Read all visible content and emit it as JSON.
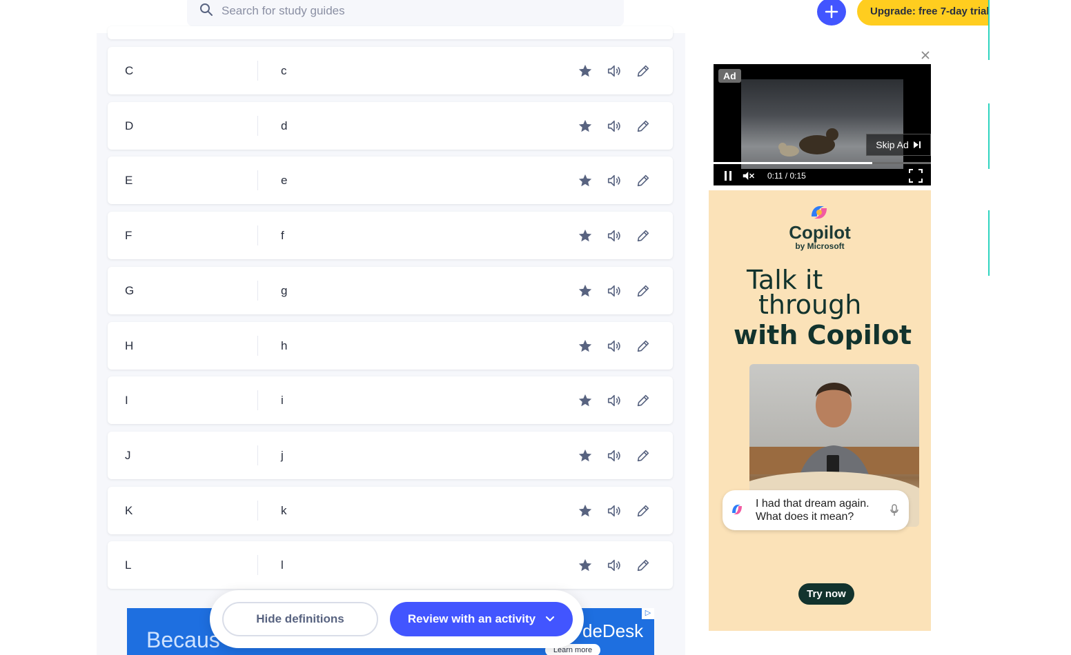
{
  "header": {
    "search_placeholder": "Search for study guides",
    "upgrade_label": "Upgrade: free 7-day trial"
  },
  "cards": [
    {
      "term": "C",
      "definition": "c"
    },
    {
      "term": "D",
      "definition": "d"
    },
    {
      "term": "E",
      "definition": "e"
    },
    {
      "term": "F",
      "definition": "f"
    },
    {
      "term": "G",
      "definition": "g"
    },
    {
      "term": "H",
      "definition": "h"
    },
    {
      "term": "I",
      "definition": "i"
    },
    {
      "term": "J",
      "definition": "j"
    },
    {
      "term": "K",
      "definition": "k"
    },
    {
      "term": "L",
      "definition": "l"
    }
  ],
  "card_icons": [
    "star-icon",
    "speaker-icon",
    "pencil-icon"
  ],
  "action_bar": {
    "hide_label": "Hide definitions",
    "review_label": "Review with an activity"
  },
  "bottom_ad": {
    "text": "Becaus",
    "brand": "deDesk",
    "learn_more": "Learn more"
  },
  "video_ad": {
    "label": "Ad",
    "skip_label": "Skip Ad",
    "time_current": "0:11",
    "time_total": "0:15",
    "progress_fraction": 0.73
  },
  "copilot_ad": {
    "brand": "Copilot",
    "sub": "by Microsoft",
    "headline_1": "Talk it",
    "headline_2": "through",
    "headline_3": "with Copilot",
    "chat_line_1": "I had that dream again.",
    "chat_line_2": "What does it mean?",
    "cta": "Try now"
  },
  "colors": {
    "accent": "#4255ff",
    "upgrade": "#ffcd1f",
    "ad_bg": "#fbe2b8",
    "dark_green": "#12332d"
  }
}
